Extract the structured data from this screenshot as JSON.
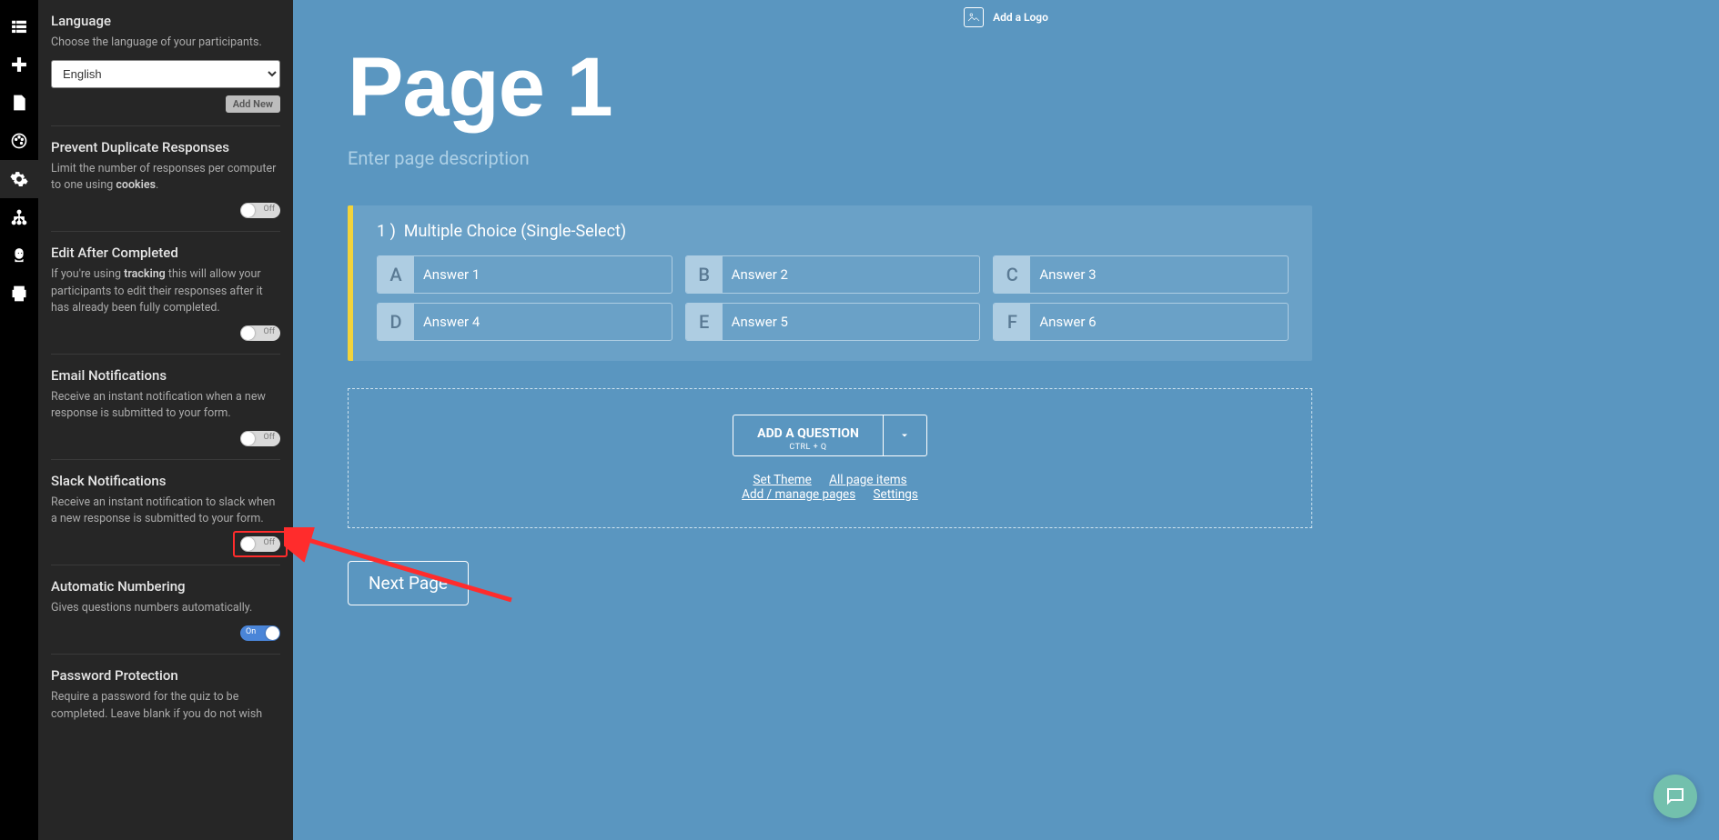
{
  "logoBar": {
    "label": "Add a Logo"
  },
  "page": {
    "title": "Page 1",
    "descPlaceholder": "Enter page description"
  },
  "question": {
    "number": "1 )",
    "title": "Multiple Choice (Single-Select)",
    "answers": [
      {
        "letter": "A",
        "text": "Answer 1"
      },
      {
        "letter": "B",
        "text": "Answer 2"
      },
      {
        "letter": "C",
        "text": "Answer 3"
      },
      {
        "letter": "D",
        "text": "Answer 4"
      },
      {
        "letter": "E",
        "text": "Answer 5"
      },
      {
        "letter": "F",
        "text": "Answer 6"
      }
    ]
  },
  "addArea": {
    "button": "ADD A QUESTION",
    "shortcut": "CTRL + Q",
    "links": {
      "theme": "Set Theme",
      "allItems": "All page items",
      "pages": "Add / manage pages",
      "settings": "Settings"
    }
  },
  "nextPage": "Next Page",
  "sidebar": {
    "language": {
      "title": "Language",
      "desc": "Choose the language of your participants.",
      "value": "English",
      "addNew": "Add New"
    },
    "duplicate": {
      "title": "Prevent Duplicate Responses",
      "descPre": "Limit the number of responses per computer to one using ",
      "descBold": "cookies",
      "descPost": ".",
      "toggle": "Off"
    },
    "editAfter": {
      "title": "Edit After Completed",
      "descPre": "If you're using ",
      "descBold": "tracking",
      "descPost": " this will allow your participants to edit their responses after it has already been fully completed.",
      "toggle": "Off"
    },
    "email": {
      "title": "Email Notifications",
      "desc": "Receive an instant notification when a new response is submitted to your form.",
      "toggle": "Off"
    },
    "slack": {
      "title": "Slack Notifications",
      "desc": "Receive an instant notification to slack when a new response is submitted to your form.",
      "toggle": "Off"
    },
    "numbering": {
      "title": "Automatic Numbering",
      "desc": "Gives questions numbers automatically.",
      "toggle": "On"
    },
    "password": {
      "title": "Password Protection",
      "desc": "Require a password for the quiz to be completed. Leave blank if you do not wish"
    }
  }
}
